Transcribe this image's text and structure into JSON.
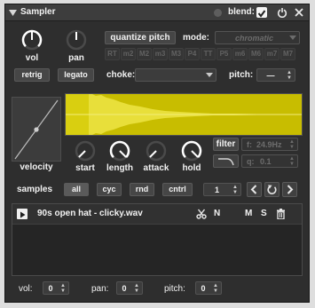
{
  "window": {
    "title": "Sampler",
    "blend_label": "blend:",
    "blend_checked": true
  },
  "main_knobs": {
    "vol_label": "vol",
    "pan_label": "pan"
  },
  "buttons": {
    "retrig": "retrig",
    "legato": "legato",
    "quantize_pitch": "quantize pitch"
  },
  "mode": {
    "label": "mode:",
    "value": "chromatic"
  },
  "intervals": [
    "RT",
    "m2",
    "M2",
    "m3",
    "M3",
    "P4",
    "TT",
    "P5",
    "m6",
    "M6",
    "m7",
    "M7"
  ],
  "choke": {
    "label": "choke:",
    "value": ""
  },
  "pitch_top": {
    "label": "pitch:",
    "value": "—"
  },
  "velocity_label": "velocity",
  "env_knobs": {
    "start": "start",
    "length": "length",
    "attack": "attack",
    "hold": "hold"
  },
  "filter": {
    "button": "filter",
    "f_label": "f:",
    "f_value": "24.9Hz",
    "q_label": "q:",
    "q_value": "0.1"
  },
  "samples": {
    "label": "samples",
    "tabs": [
      "all",
      "cyc",
      "rnd",
      "cntrl"
    ],
    "active_tab": "all",
    "count": "1",
    "list": [
      {
        "name": "90s open hat - clicky.wav",
        "n": "N",
        "m": "M",
        "s": "S"
      }
    ]
  },
  "bottom": {
    "vol_label": "vol:",
    "vol_value": "0",
    "pan_label": "pan:",
    "pan_value": "0",
    "pitch_label": "pitch:",
    "pitch_value": "0"
  },
  "colors": {
    "waveform": "#c8bd00",
    "panel": "#2e2e2e",
    "knob_arc": "#ffffff"
  }
}
